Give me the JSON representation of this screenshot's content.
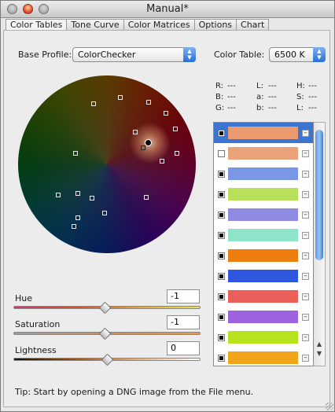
{
  "window": {
    "title": "Manual*"
  },
  "tabs": [
    {
      "label": "Color Tables",
      "active": true
    },
    {
      "label": "Tone Curve"
    },
    {
      "label": "Color Matrices"
    },
    {
      "label": "Options"
    },
    {
      "label": "Chart"
    }
  ],
  "base_profile": {
    "label": "Base Profile:",
    "value": "ColorChecker"
  },
  "color_table": {
    "label": "Color Table:",
    "value": "6500 K"
  },
  "readouts": [
    {
      "label": "R:",
      "value": "---"
    },
    {
      "label": "L:",
      "value": "---"
    },
    {
      "label": "H:",
      "value": "---"
    },
    {
      "label": "B:",
      "value": "---"
    },
    {
      "label": "a:",
      "value": "---"
    },
    {
      "label": "S:",
      "value": "---"
    },
    {
      "label": "G:",
      "value": "---"
    },
    {
      "label": "b:",
      "value": "---"
    },
    {
      "label": "L:",
      "value": "---"
    }
  ],
  "sliders": {
    "hue": {
      "label": "Hue",
      "value": "-1"
    },
    "saturation": {
      "label": "Saturation",
      "value": "-1"
    },
    "lightness": {
      "label": "Lightness",
      "value": "0"
    }
  },
  "swatches": [
    {
      "color": "#eb9a70",
      "checked": true,
      "selected": true
    },
    {
      "color": "#eaa27a",
      "checked": false
    },
    {
      "color": "#7a97e6",
      "checked": true
    },
    {
      "color": "#b8e05a",
      "checked": true
    },
    {
      "color": "#8f8be2",
      "checked": true
    },
    {
      "color": "#8ee4c9",
      "checked": true
    },
    {
      "color": "#ee7d10",
      "checked": true
    },
    {
      "color": "#2e56df",
      "checked": true
    },
    {
      "color": "#ea5f5a",
      "checked": true
    },
    {
      "color": "#9c62e0",
      "checked": true
    },
    {
      "color": "#b6e21e",
      "checked": true
    },
    {
      "color": "#f2a51a",
      "checked": true
    }
  ],
  "tip": "Tip: Start by opening a DNG image from the File menu.",
  "icons": {
    "popup_arrows": "up-down-arrows-icon",
    "remove": "minus-icon"
  },
  "colors": {
    "accent": "#3b74d1",
    "close_button": "#e0502a"
  }
}
